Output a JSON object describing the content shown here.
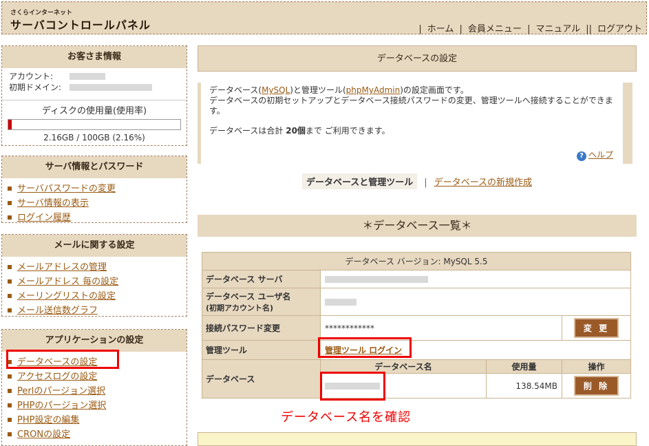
{
  "header": {
    "logo_small": "さくらインターネット",
    "logo_big": "サーバコントロールパネル",
    "nav": [
      "ホーム",
      "会員メニュー",
      "マニュアル",
      "ログアウト"
    ]
  },
  "account": {
    "title": "お客さま情報",
    "account_label": "アカウント:",
    "domain_label": "初期ドメイン:",
    "disk_title": "ディスクの使用量(使用率)",
    "disk_usage_fraction": 0.0216,
    "disk_text": "2.16GB / 100GB (2.16%)"
  },
  "server_info": {
    "title": "サーバ情報とパスワード",
    "items": [
      "サーバパスワードの変更",
      "サーバ情報の表示",
      "ログイン履歴"
    ]
  },
  "mail": {
    "title": "メールに関する設定",
    "items": [
      "メールアドレスの管理",
      "メールアドレス 毎の設定",
      "メーリングリストの設定",
      "メール送信数グラフ"
    ]
  },
  "app": {
    "title": "アプリケーションの設定",
    "items": [
      "データベースの設定",
      "アクセスログの設定",
      "Perlのパージョン選択",
      "PHPのパージョン選択",
      "PHP設定の編集",
      "CRONの設定"
    ]
  },
  "main": {
    "title": "データベースの設定",
    "intro_prefix": "データベース(",
    "intro_mysql": "MySQL",
    "intro_mid": ")と管理ツール(",
    "intro_pma": "phpMyAdmin",
    "intro_suffix": ")の設定画面です。",
    "intro_line2": "データベースの初期セットアップとデータベース接続パスワードの変更、管理ツールへ接続することができます。",
    "intro_count_prefix": "データベースは合計 ",
    "intro_count": "20個",
    "intro_count_suffix": "まで ご利用できます。",
    "help_label": "ヘルプ",
    "tab_active": "データベースと管理ツール",
    "tab_sep": "|",
    "tab_new": "データベースの新規作成",
    "list_title": "＊データベース一覧＊"
  },
  "db_table": {
    "version_header": "データベース バージョン: MySQL 5.5",
    "server_label": "データベース サーバ",
    "user_label_1": "データベース ユーザ名",
    "user_label_2": "(初期アカウント名)",
    "password_label": "接続パスワード変更",
    "password_value": "************",
    "change_button": "変 更",
    "tool_label": "管理ツール",
    "tool_link": "管理ツール ログイン",
    "db_label": "データベース",
    "col_name": "データベース名",
    "col_usage": "使用量",
    "col_action": "操作",
    "usage_value": "138.54MB",
    "delete_button": "削 除"
  },
  "annotation": "データベース名を確認"
}
